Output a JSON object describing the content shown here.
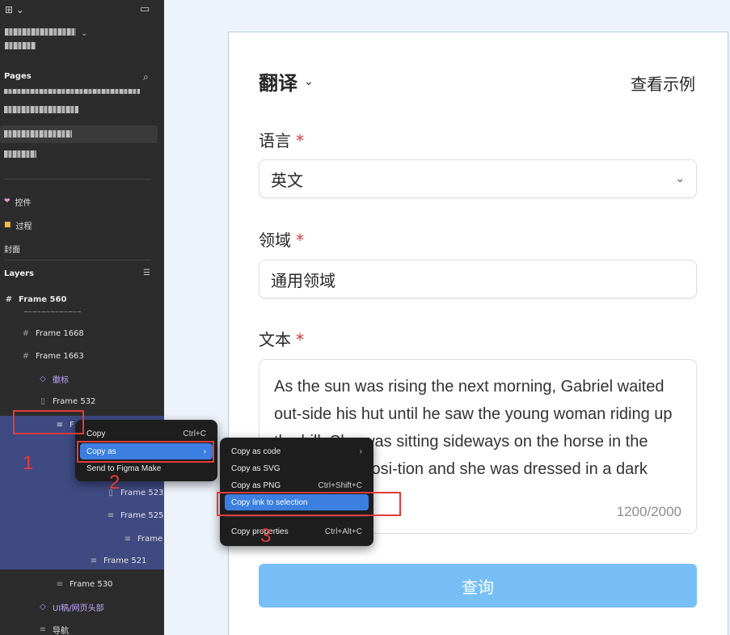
{
  "sidebar": {
    "pages_title": "Pages",
    "pages": [
      {
        "label": "控件",
        "icon": "heart-icon"
      },
      {
        "label": "过程",
        "icon": "folder-icon"
      },
      {
        "label": "封面",
        "icon": ""
      }
    ],
    "layers_title": "Layers",
    "root_frame": "Frame 560",
    "layers": [
      {
        "label": "Frame 1668"
      },
      {
        "label": "Frame 1663"
      },
      {
        "label": "徽标"
      },
      {
        "label": "Frame 532"
      },
      {
        "label": "F"
      },
      {
        "label": "Frame 523"
      },
      {
        "label": "Frame 525"
      },
      {
        "label": "Frame"
      },
      {
        "label": "Frame 521"
      },
      {
        "label": "Frame 530"
      },
      {
        "label": "UI稿/网页头部"
      },
      {
        "label": "导航"
      }
    ]
  },
  "context_menu": {
    "items": [
      {
        "label": "Copy",
        "shortcut": "Ctrl+C"
      },
      {
        "label": "Copy as",
        "submenu_arrow": "›"
      },
      {
        "label": "Send to Figma Make"
      }
    ]
  },
  "copy_as_menu": {
    "items": [
      {
        "label": "Copy as code",
        "submenu_arrow": "›"
      },
      {
        "label": "Copy as SVG"
      },
      {
        "label": "Copy as PNG",
        "shortcut": "Ctrl+Shift+C"
      },
      {
        "label": "Copy link to selection"
      },
      {
        "label": "Copy properties",
        "shortcut": "Ctrl+Alt+C"
      }
    ]
  },
  "annotations": [
    "1",
    "2",
    "3"
  ],
  "form": {
    "title": "翻译",
    "example_link": "查看示例",
    "language_label": "语言",
    "language_value": "英文",
    "domain_label": "领域",
    "domain_value": "通用领域",
    "text_label": "文本",
    "required_mark": "*",
    "text_value": "As the sun was rising the next morning,  Gabriel waited out-side his hut until he saw the young woman riding up the hill. She was sitting sideways on the horse in the usual lady's posi-tion and she was dressed in a dark habit.",
    "char_count": "1200/2000",
    "submit_label": "查询"
  },
  "colors": {
    "sidebar_bg": "#2c2c2c",
    "selection_bg": "#3f4a82",
    "menu_highlight": "#3b7fe1",
    "annotation_red": "#e23b3b",
    "required_red": "#d9363e",
    "submit_bg": "#78bff7"
  }
}
